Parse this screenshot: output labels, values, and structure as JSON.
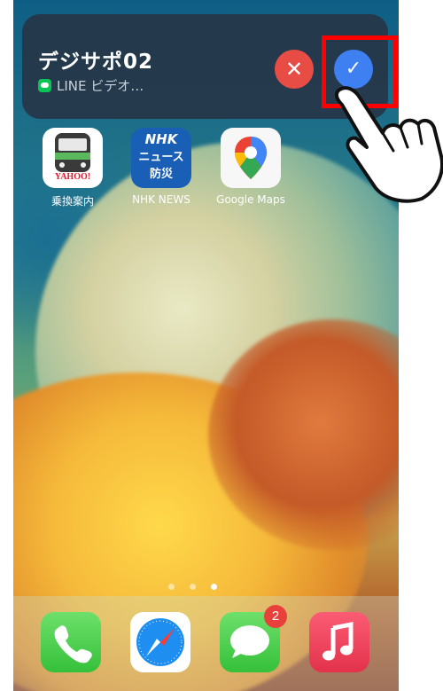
{
  "notification": {
    "title": "デジサポ02",
    "subtitle": "LINE ビデオ…",
    "decline_symbol": "✕",
    "accept_symbol": "✓",
    "highlight_color": "#ff0000"
  },
  "home_apps": [
    {
      "label": "乗換案内",
      "icon": "transit-train-icon"
    },
    {
      "label": "NHK NEWS",
      "icon": "nhk-news-icon",
      "icon_text_1": "NHK",
      "icon_text_2": "ニュース",
      "icon_text_3": "防災"
    },
    {
      "label": "Google Maps",
      "icon": "google-maps-pin-icon"
    }
  ],
  "transit_icon_text": "YAHOO!",
  "page_dots": {
    "count": 3,
    "active_index": 2
  },
  "dock": [
    {
      "name": "phone",
      "icon": "phone-icon"
    },
    {
      "name": "safari",
      "icon": "compass-icon"
    },
    {
      "name": "messages",
      "icon": "speech-bubble-icon",
      "badge": "2"
    },
    {
      "name": "music",
      "icon": "music-note-icon"
    }
  ]
}
